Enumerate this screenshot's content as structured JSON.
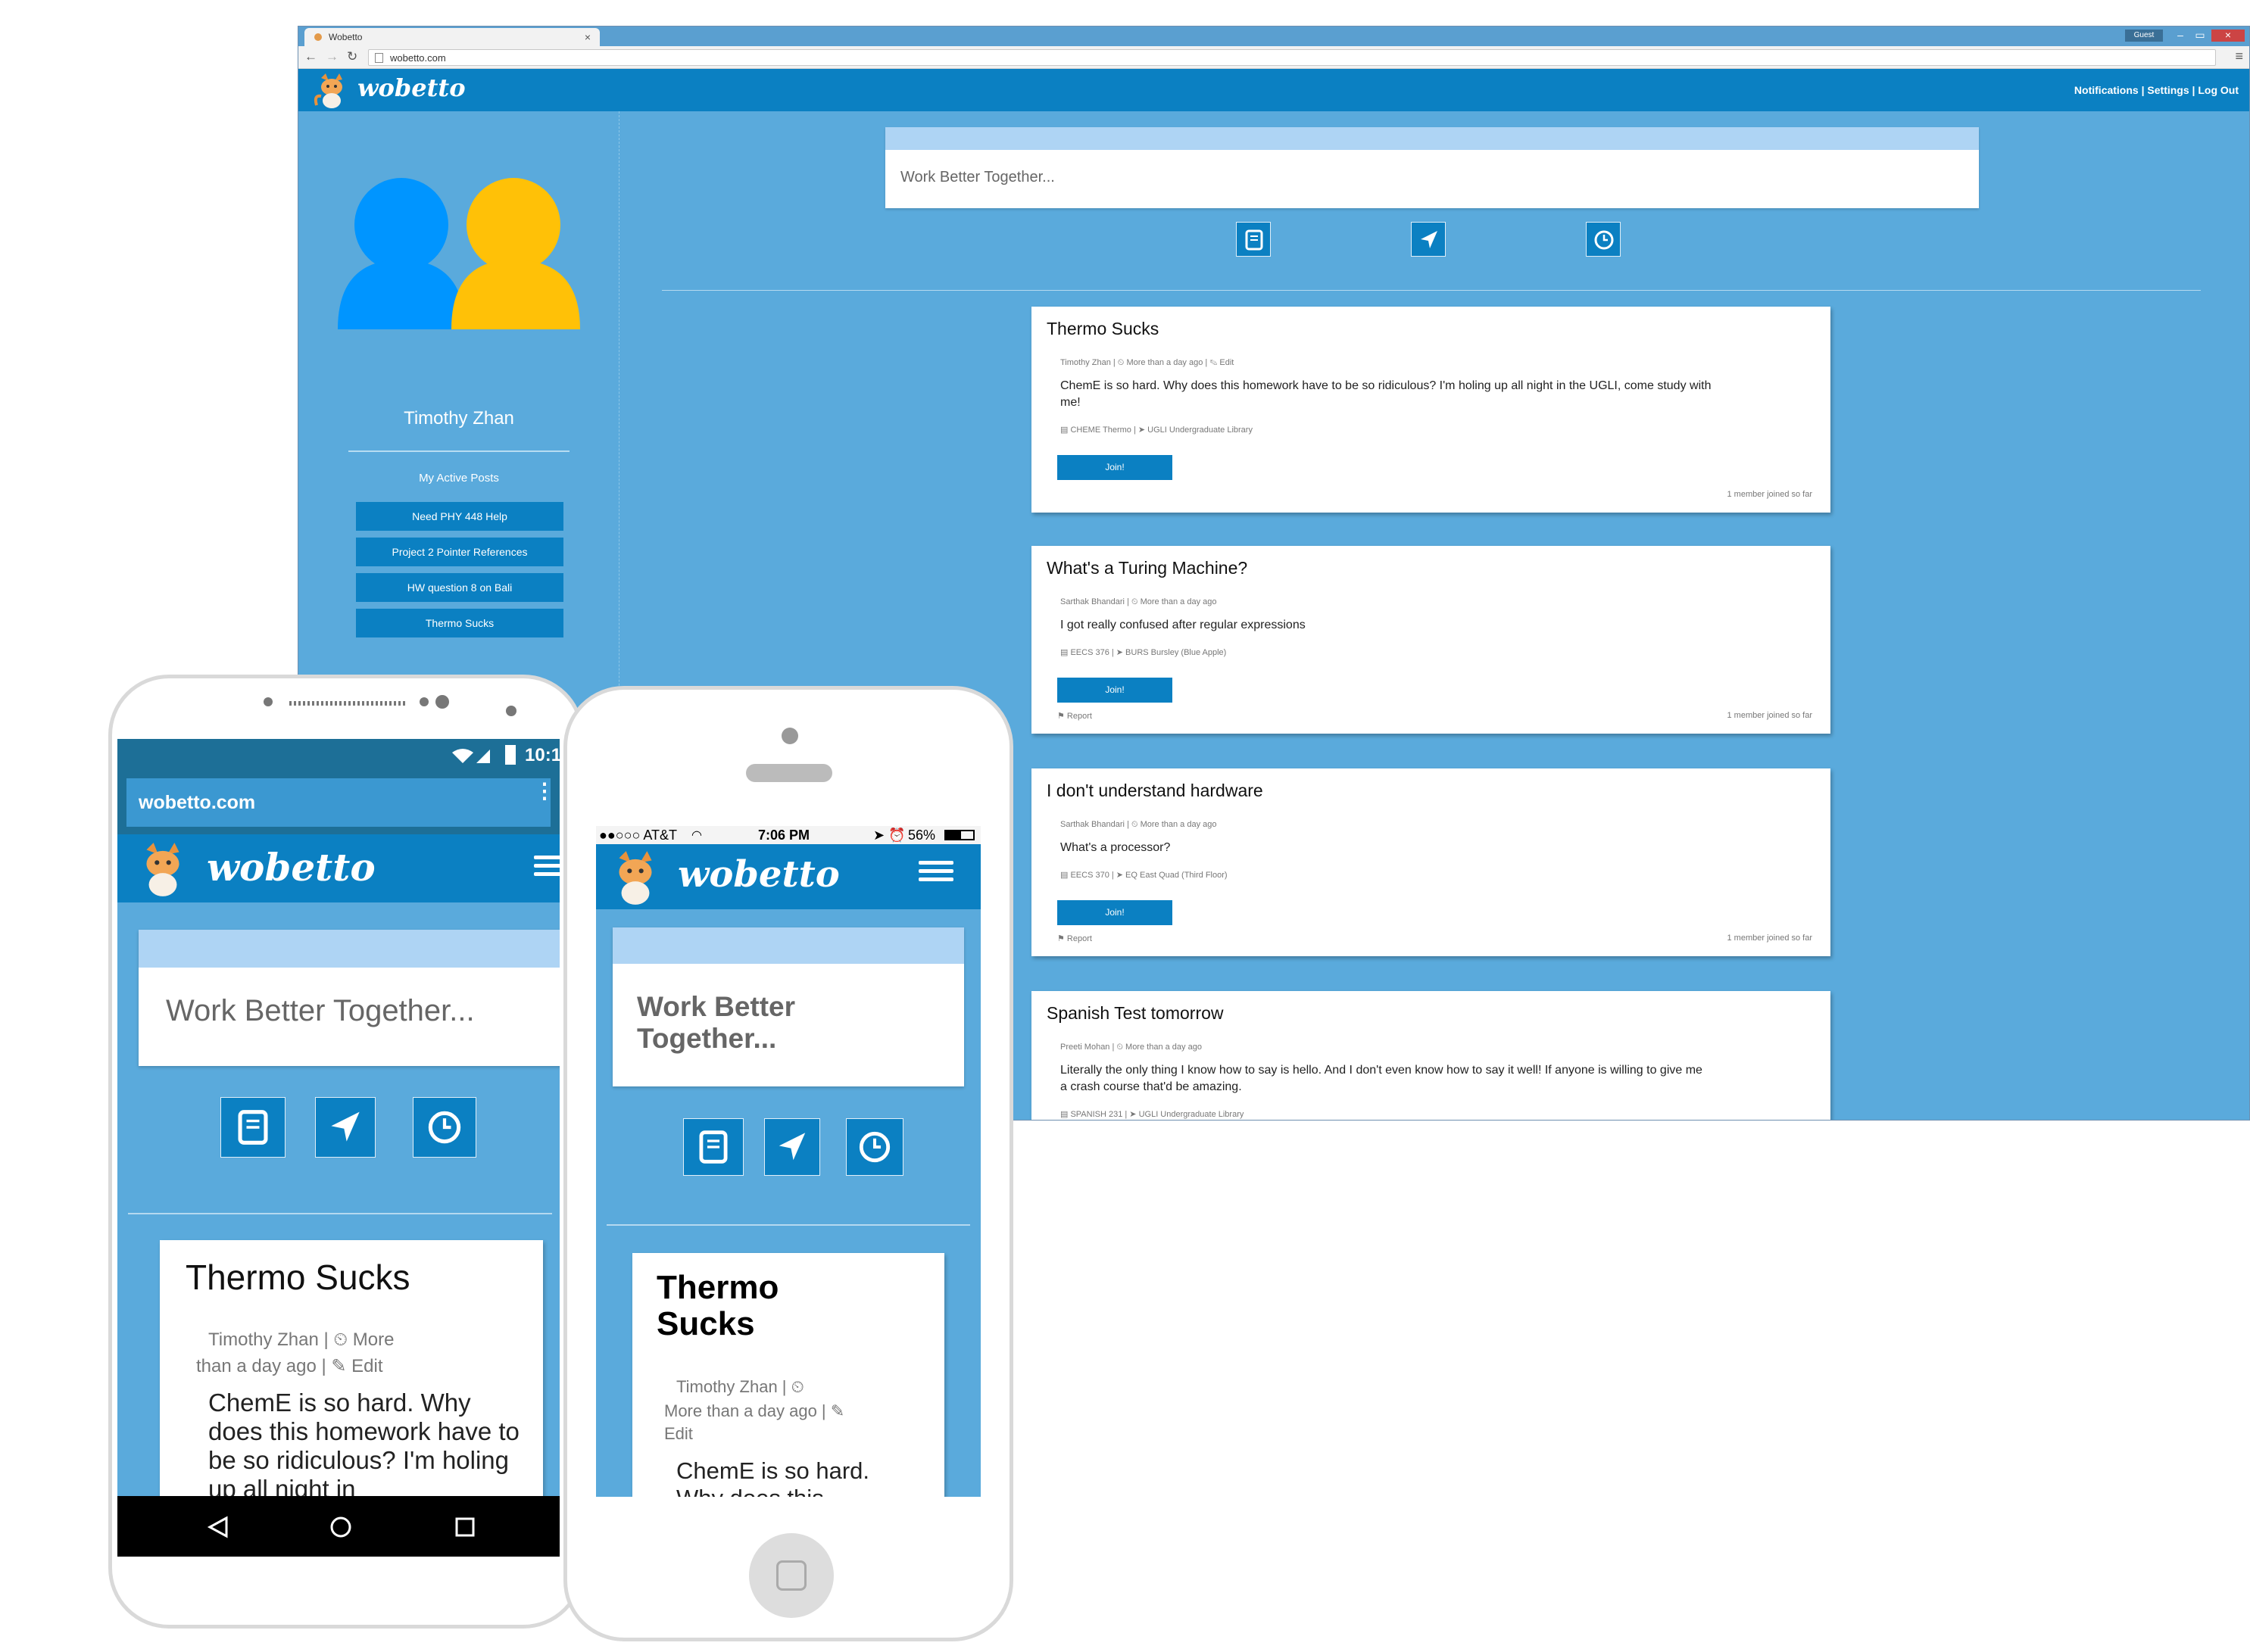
{
  "browser": {
    "tab_title": "Wobetto",
    "tab_close": "×",
    "guest_label": "Guest",
    "url": "wobetto.com"
  },
  "app": {
    "logo_text": "wobetto",
    "nav": {
      "notifications": "Notifications",
      "settings": "Settings",
      "logout": "Log Out",
      "separator": "|"
    },
    "search_placeholder": "Work Better Together...",
    "filter_icons": [
      "book-icon",
      "location-arrow-icon",
      "clock-icon"
    ],
    "colors": {
      "primary": "#0b80c2",
      "background": "#5aaadc",
      "search_band": "#aed4f4",
      "avatar_blue": "#0095ff",
      "avatar_yellow": "#ffc107"
    }
  },
  "sidebar": {
    "user_name": "Timothy Zhan",
    "active_posts_heading": "My Active Posts",
    "posts": [
      "Need PHY 448 Help",
      "Project 2 Pointer References",
      "HW question 8 on Bali",
      "Thermo Sucks"
    ]
  },
  "posts": [
    {
      "title": "Thermo Sucks",
      "meta": "Timothy Zhan | ⏲ More than a day ago | ✎ Edit",
      "body": "ChemE is so hard. Why does this homework have to be so ridiculous? I'm holing up all night in the UGLI, come study with me!",
      "location": "▤ CHEME Thermo | ➤ UGLI Undergraduate Library",
      "join_label": "Join!",
      "report_label": "",
      "members": "1 member joined so far"
    },
    {
      "title": "What's a Turing Machine?",
      "meta": "Sarthak Bhandari | ⏲ More than a day ago",
      "body": "I got really confused after regular expressions",
      "location": "▤ EECS 376 | ➤ BURS Bursley (Blue Apple)",
      "join_label": "Join!",
      "report_label": "⚑ Report",
      "members": "1 member joined so far"
    },
    {
      "title": "I don't understand hardware",
      "meta": "Sarthak Bhandari | ⏲ More than a day ago",
      "body": "What's a processor?",
      "location": "▤ EECS 370 | ➤ EQ East Quad (Third Floor)",
      "join_label": "Join!",
      "report_label": "⚑ Report",
      "members": "1 member joined so far"
    },
    {
      "title": "Spanish Test tomorrow",
      "meta": "Preeti Mohan | ⏲ More than a day ago",
      "body": "Literally the only thing I know how to say is hello. And I don't even know how to say it well! If anyone is willing to give me a crash course that'd be amazing.",
      "location": "▤ SPANISH 231 | ➤ UGLI Undergraduate Library",
      "join_label": "",
      "report_label": "",
      "members": ""
    }
  ],
  "android": {
    "time": "10:1",
    "url": "wobetto.com",
    "logo_text": "wobetto",
    "search_placeholder": "Work Better Together...",
    "card": {
      "title": "Thermo Sucks",
      "meta_line1": "Timothy Zhan | ⏲ More",
      "meta_line2": "than a day ago | ✎ Edit",
      "body": "ChemE is so hard. Why does this homework have to be so ridiculous? I'm holing up all night in"
    }
  },
  "iphone": {
    "carrier": "●●○○○ AT&T",
    "time": "7:06 PM",
    "battery": "56%",
    "logo_text": "wobetto",
    "search_placeholder": "Work Better Together...",
    "card": {
      "title": "Thermo Sucks",
      "meta_line1": "Timothy Zhan | ⏲",
      "meta_line2": "More than a day ago | ✎",
      "meta_line3": "Edit",
      "body": "ChemE is so hard. Why does this"
    }
  }
}
